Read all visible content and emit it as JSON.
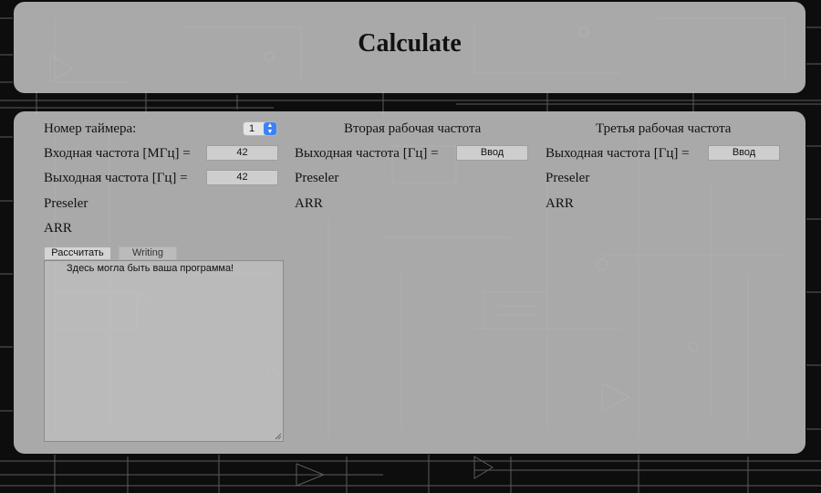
{
  "header": {
    "title": "Calculate"
  },
  "col1": {
    "timer_label": "Номер таймера:",
    "timer_value": "1",
    "input_freq_label": "Входная частота [МГц] =",
    "input_freq_value": "42",
    "output_freq_label": "Выходная частота [Гц] =",
    "output_freq_value": "42",
    "preseler_label": "Preseler",
    "arr_label": "ARR"
  },
  "col2": {
    "title": "Вторая рабочая частота",
    "output_freq_label": "Выходная частота [Гц] =",
    "input_placeholder": "Ввод",
    "preseler_label": "Preseler",
    "arr_label": "ARR"
  },
  "col3": {
    "title": "Третья рабочая частота",
    "output_freq_label": "Выходная частота [Гц] =",
    "input_placeholder": "Ввод",
    "preseler_label": "Preseler",
    "arr_label": "ARR"
  },
  "actions": {
    "calculate_label": "Рассчитать",
    "writing_label": "Writing"
  },
  "output": {
    "text": "Здесь могла быть ваша программа!"
  },
  "colors": {
    "panel": "#c4c4c4",
    "background": "#0d0d0d",
    "select_accent": "#3b82f6"
  }
}
